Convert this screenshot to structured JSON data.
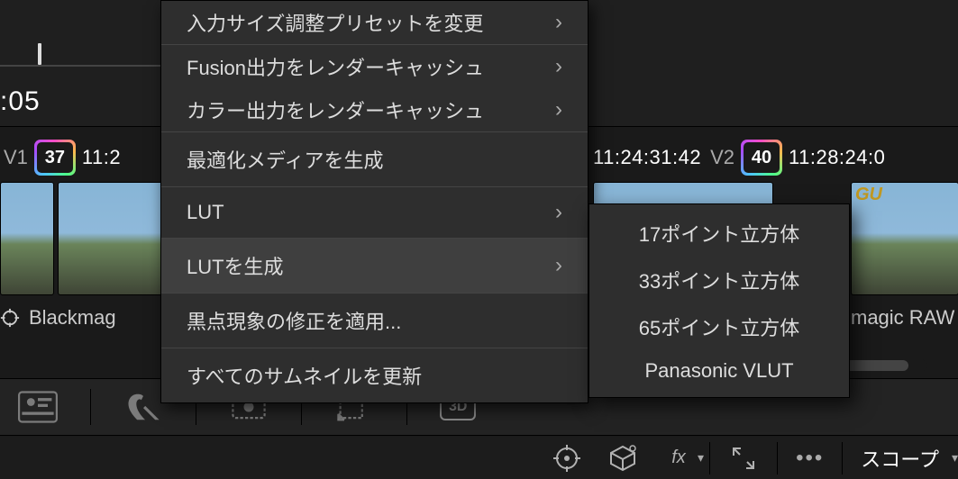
{
  "top": {
    "timecode_fragment": ":05"
  },
  "clips": {
    "left_footer": "Blackmag",
    "right_footer": "magic RAW",
    "c1": {
      "v": "V1",
      "num": "37",
      "tc": "11:2"
    },
    "c2": {
      "tc": "11:24:31:42",
      "v": "V2"
    },
    "c3": {
      "num": "40",
      "tc": "11:28:24:0",
      "gu": "GU"
    }
  },
  "menu": {
    "item0": "入力サイズ調整プリセットを変更",
    "item1": "Fusion出力をレンダーキャッシュ",
    "item2": "カラー出力をレンダーキャッシュ",
    "item3": "最適化メディアを生成",
    "item4": "LUT",
    "item5": "LUTを生成",
    "item6": "黒点現象の修正を適用...",
    "item7": "すべてのサムネイルを更新"
  },
  "submenu": {
    "i0": "17ポイント立方体",
    "i1": "33ポイント立方体",
    "i2": "65ポイント立方体",
    "i3": "Panasonic VLUT"
  },
  "toolbar": {
    "d3": "3D"
  },
  "bottom": {
    "scope": "スコープ",
    "fx": "fx"
  }
}
